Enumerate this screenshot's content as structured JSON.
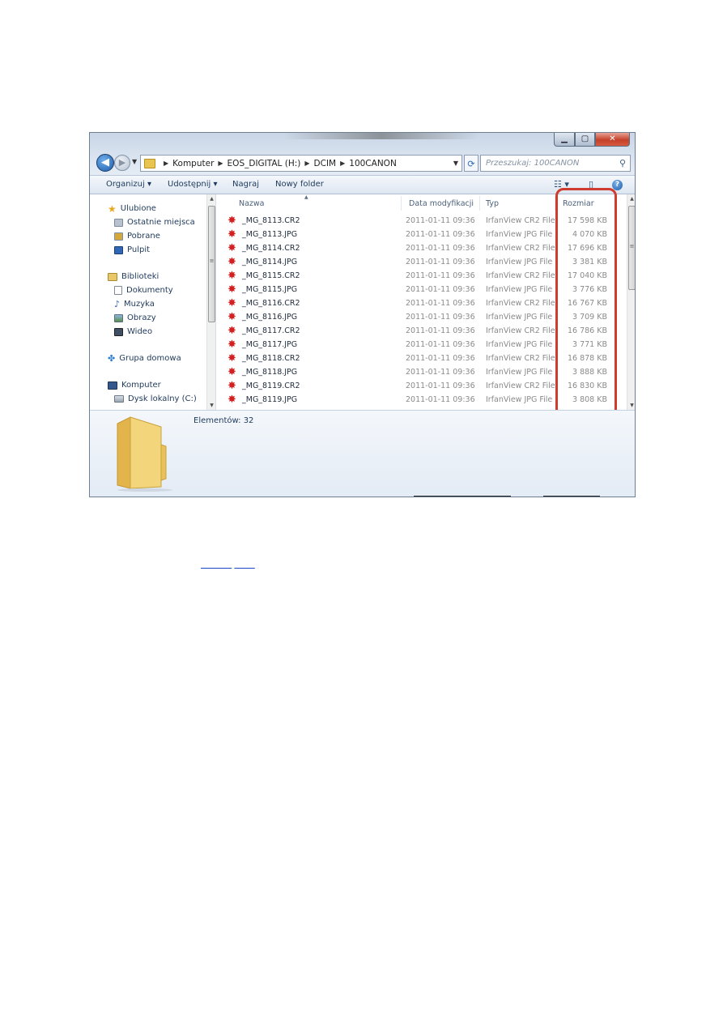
{
  "window": {
    "address": {
      "segments": [
        "Komputer",
        "EOS_DIGITAL (H:)",
        "DCIM",
        "100CANON"
      ]
    },
    "search": {
      "placeholder": "Przeszukaj: 100CANON"
    },
    "toolbar": {
      "organize": "Organizuj ▾",
      "share": "Udostępnij ▾",
      "burn": "Nagraj",
      "new_folder": "Nowy folder"
    },
    "nav": {
      "favorites": {
        "label": "Ulubione",
        "items": [
          "Ostatnie miejsca",
          "Pobrane",
          "Pulpit"
        ]
      },
      "libraries": {
        "label": "Biblioteki",
        "items": [
          "Dokumenty",
          "Muzyka",
          "Obrazy",
          "Wideo"
        ]
      },
      "homegroup": "Grupa domowa",
      "computer": {
        "label": "Komputer",
        "items": [
          "Dysk lokalny (C:)"
        ]
      }
    },
    "columns": {
      "name": "Nazwa",
      "date": "Data modyfikacji",
      "type": "Typ",
      "size": "Rozmiar"
    },
    "files": [
      {
        "name": "_MG_8113.CR2",
        "date": "2011-01-11 09:36",
        "type": "IrfanView CR2 File",
        "size": "17 598 KB"
      },
      {
        "name": "_MG_8113.JPG",
        "date": "2011-01-11 09:36",
        "type": "IrfanView JPG File",
        "size": "4 070 KB"
      },
      {
        "name": "_MG_8114.CR2",
        "date": "2011-01-11 09:36",
        "type": "IrfanView CR2 File",
        "size": "17 696 KB"
      },
      {
        "name": "_MG_8114.JPG",
        "date": "2011-01-11 09:36",
        "type": "IrfanView JPG File",
        "size": "3 381 KB"
      },
      {
        "name": "_MG_8115.CR2",
        "date": "2011-01-11 09:36",
        "type": "IrfanView CR2 File",
        "size": "17 040 KB"
      },
      {
        "name": "_MG_8115.JPG",
        "date": "2011-01-11 09:36",
        "type": "IrfanView JPG File",
        "size": "3 776 KB"
      },
      {
        "name": "_MG_8116.CR2",
        "date": "2011-01-11 09:36",
        "type": "IrfanView CR2 File",
        "size": "16 767 KB"
      },
      {
        "name": "_MG_8116.JPG",
        "date": "2011-01-11 09:36",
        "type": "IrfanView JPG File",
        "size": "3 709 KB"
      },
      {
        "name": "_MG_8117.CR2",
        "date": "2011-01-11 09:36",
        "type": "IrfanView CR2 File",
        "size": "16 786 KB"
      },
      {
        "name": "_MG_8117.JPG",
        "date": "2011-01-11 09:36",
        "type": "IrfanView JPG File",
        "size": "3 771 KB"
      },
      {
        "name": "_MG_8118.CR2",
        "date": "2011-01-11 09:36",
        "type": "IrfanView CR2 File",
        "size": "16 878 KB"
      },
      {
        "name": "_MG_8118.JPG",
        "date": "2011-01-11 09:36",
        "type": "IrfanView JPG File",
        "size": "3 888 KB"
      },
      {
        "name": "_MG_8119.CR2",
        "date": "2011-01-11 09:36",
        "type": "IrfanView CR2 File",
        "size": "16 830 KB"
      },
      {
        "name": "_MG_8119.JPG",
        "date": "2011-01-11 09:36",
        "type": "IrfanView JPG File",
        "size": "3 808 KB"
      }
    ],
    "status": {
      "count": "Elementów: 32"
    },
    "icons": {
      "back": "back-arrow-icon",
      "forward": "forward-arrow-icon",
      "refresh": "refresh-icon",
      "search": "search-icon",
      "views": "view-options-icon",
      "preview": "preview-pane-icon",
      "help": "help-icon",
      "file": "irfanview-file-icon",
      "folder": "folder-icon"
    },
    "colors": {
      "highlight": "#cf3b2f",
      "file_icon": "#d42020"
    }
  }
}
